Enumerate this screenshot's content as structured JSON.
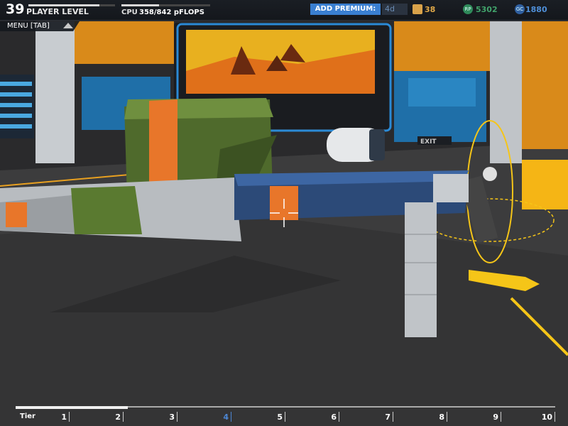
{
  "hud": {
    "player_level": "39",
    "player_level_label": "PLAYER LEVEL",
    "level_progress": 0.82,
    "cpu_label": "CPU",
    "cpu_value": "358/842 pFLOPS",
    "cpu_progress": 0.425,
    "add_premium_label": "ADD PREMIUM:",
    "premium_days": "4d",
    "cubes": "38",
    "rp": "5302",
    "gc": "1880",
    "rp_icon": "RP",
    "gc_icon": "GC"
  },
  "menu": {
    "label": "MENU [TAB]"
  },
  "scene": {
    "exit_sign": "EXIT"
  },
  "tier": {
    "label": "Tier",
    "current": 4,
    "levels": [
      "1",
      "2",
      "3",
      "4",
      "5",
      "6",
      "7",
      "8",
      "9",
      "10"
    ]
  },
  "colors": {
    "accent_blue": "#3a7fd1",
    "orange": "#e8832a",
    "yellow": "#f5c518",
    "green_armor": "#5a7a30",
    "blue_armor": "#2c4a78"
  }
}
